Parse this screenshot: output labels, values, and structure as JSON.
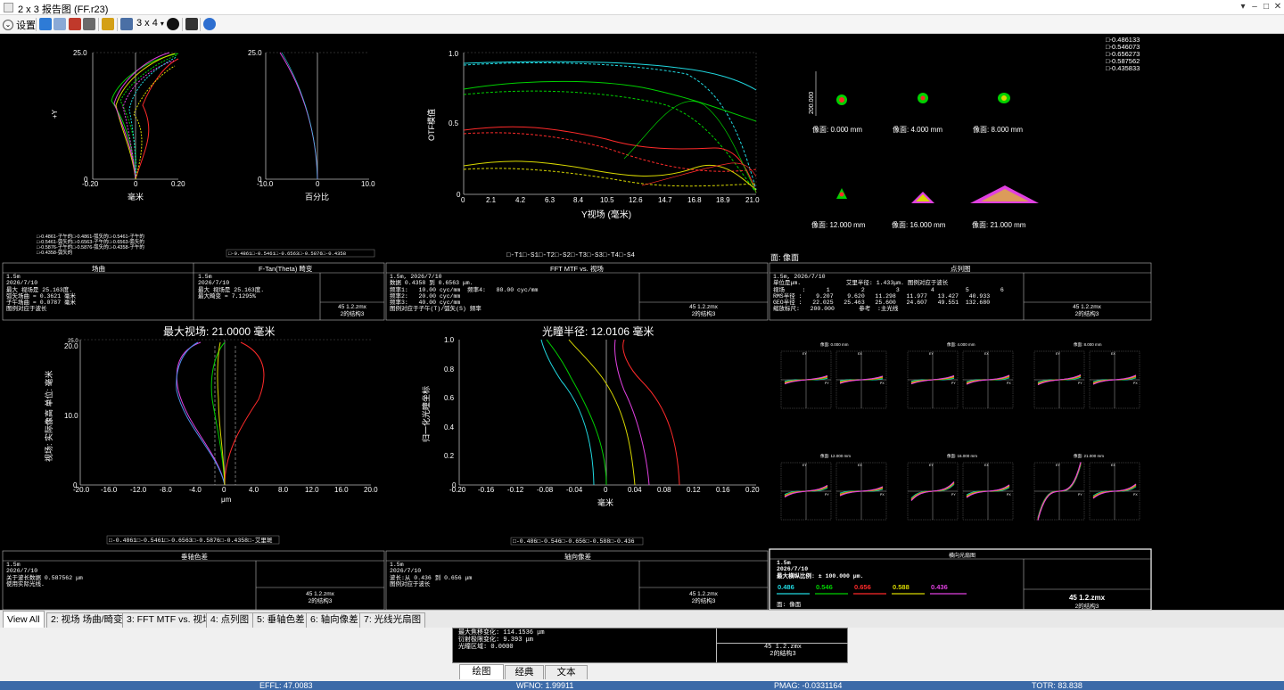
{
  "window": {
    "title": "2 x 3 报告图 (FF.r23)",
    "minimize": "▾",
    "restore": "–",
    "maximize": "□",
    "close": "✕"
  },
  "toolbar": {
    "settings_label": "设置",
    "layout_label": "3 x 4",
    "layout_arrow": "▾"
  },
  "field_curvature": {
    "y_top": "25.0",
    "y_bottom": "0",
    "y_label": "+Y",
    "x_ticks": [
      "-0.20",
      "0",
      "0.20"
    ],
    "x_unit": "毫米",
    "legend_lines": [
      "□-0.4861-子午的□-0.4861-弧矢的□-0.5461-子午的",
      "□-0.5461-弧矢的□-0.6563-子午的□-0.6563-弧矢的",
      "□-0.5876-子午的□-0.5876-弧矢的□-0.4358-子午的",
      "□-0.4358-弧矢的"
    ]
  },
  "distortion": {
    "y_top": "25.0",
    "y_bottom": "0",
    "x_ticks": [
      "-10.0",
      "0",
      "10.0"
    ],
    "x_unit": "百分比",
    "legend": "□-0.4861□-0.5461□-0.6563□-0.5876□-0.4358"
  },
  "mtf": {
    "y_ticks": [
      "1.0",
      "0.5",
      "0"
    ],
    "y_label": "OTF模值",
    "x_ticks": [
      "0",
      "2.1",
      "4.2",
      "6.3",
      "8.4",
      "10.5",
      "12.6",
      "14.7",
      "16.8",
      "18.9",
      "21.0"
    ],
    "x_label": "Y视场 (毫米)",
    "legend": "□-T1□-S1□-T2□-S2□-T3□-S3□-T4□-S4"
  },
  "spot": {
    "header": "面: 像面",
    "wavelengths": [
      "□-0.486133",
      "□-0.546073",
      "□-0.656273",
      "□-0.587562",
      "□-0.435833"
    ],
    "scale_label": "200.000",
    "fields": [
      "像面: 0.000 mm",
      "像面: 4.000 mm",
      "像面: 8.000 mm",
      "像面: 12.000 mm",
      "像面: 16.000 mm",
      "像面: 21.000 mm"
    ]
  },
  "info1": {
    "sec_a": "场曲",
    "sec_b": "F-Tan(Theta) 畸变",
    "sec_c": "FFT MTF vs. 视场",
    "sec_d": "点列图",
    "a_lines": "1.5m\n2026/7/10\n最大 视场是 25.163度.\n弧矢场曲 = 0.3621 毫米\n子午场曲 = 0.0787 毫米\n图例对应于波长",
    "b_lines": "1.5m\n2026/7/10\n最大 视场是 25.163度.\n最大畸变 = 7.1295%",
    "c_lines": "1.5m, 2026/7/10\n数据 0.4358 到 0.6563 μm.\n频率1:   10.00 cyc/mm  频率4:   80.00 cyc/mm\n频率2:   20.00 cyc/mm\n频率3:   40.00 cyc/mm\n图例对应于子午(T)/弧矢(S) 频率",
    "d_lines": "1.5m, 2026/7/10\n单位是μm.             艾里半径: 1.433μm. 图例对应于波长\n视场     :      1         2         3         4         5         6\nRMS半径 :    9.207    9.620   11.298   11.977   13.427   40.933\nGEO半径 :   22.025   25.463   25.600   24.607   49.551  132.680\n缩放标尺:   200.000       参考  :主光线",
    "file_name": "45 1.2.zmx",
    "config": "2的结构3"
  },
  "lateral_color": {
    "title": "最大视场: 21.0000 毫米",
    "y_label": "视场: 实际像高 单位: 毫米",
    "y_ticks": [
      "25.0",
      "20.0",
      "10.0",
      "0"
    ],
    "x_ticks": [
      "-20.0",
      "-16.0",
      "-12.0",
      "-8.0",
      "-4.0",
      "0",
      "4.0",
      "8.0",
      "12.0",
      "16.0",
      "20.0"
    ],
    "x_unit": "μm",
    "legend": "□-0.4861□-0.5461□-0.6563□-0.5876□-0.4358□-艾里斑"
  },
  "long_aberration": {
    "title": "光瞳半径: 12.0106 毫米",
    "y_label": "归一化光瞳坐标",
    "y_ticks": [
      "1.0",
      "0.8",
      "0.6",
      "0.4",
      "0.2",
      "0"
    ],
    "x_ticks": [
      "-0.20",
      "-0.16",
      "-0.12",
      "-0.08",
      "-0.04",
      "0",
      "0.04",
      "0.08",
      "0.12",
      "0.16",
      "0.20"
    ],
    "x_unit": "毫米",
    "legend": "□-0.486□-0.546□-0.656□-0.588□-0.436"
  },
  "ray_fan": {
    "fields": [
      "像面: 0.000 mm",
      "像面: 4.000 mm",
      "像面: 8.000 mm",
      "像面: 12.000 mm",
      "像面: 16.000 mm",
      "像面: 21.000 mm"
    ],
    "ey": "EY",
    "ex": "EX",
    "py": "PY",
    "px": "PX"
  },
  "info2": {
    "sec_a": "垂轴色差",
    "sec_b": "轴向像差",
    "sec_c": "横向光扇图",
    "a_lines": "1.5m\n2026/7/10\n关于波长数据 0.587562 μm\n使用实际光线.",
    "b_lines": "1.5m\n2026/7/10\n波长:从 0.436 到 0.656 μm\n图例对应于波长",
    "c_lines": "1.5m\n2026/7/10\n最大横纵比例: ± 100.000 μm.",
    "c_waves": [
      "0.486",
      "0.546",
      "0.656",
      "0.588",
      "0.436"
    ],
    "c_face": "面: 像面",
    "file_name": "45 1.2.zmx",
    "config": "2的结构3"
  },
  "tabs": [
    "View All",
    "2: 视场 场曲/畸变",
    "3: FFT MTF vs. 视场",
    "4: 点列图",
    "5: 垂轴色差",
    "6: 轴向像差",
    "7: 光线光扇图"
  ],
  "text_window": {
    "lines": "最大焦移变化: 114.1536 μm\n衍射极限变化: 9.393 μm\n光瞳区域: 0.0000",
    "file_name": "45 1.2.zmx",
    "config": "2的结构3"
  },
  "bottom_tabs": [
    "绘图",
    "经典",
    "文本"
  ],
  "status": {
    "effl": "EFFL: 47.0083",
    "wfno": "WFNO: 1.99911",
    "pmag": "PMAG: -0.0331164",
    "totr": "TOTR: 83.838"
  },
  "colors": {
    "blue": "#4a8fe8",
    "green": "#00d000",
    "red": "#ff2a2a",
    "yellow": "#d8d800",
    "magenta": "#e040e0",
    "cyan": "#20d8e0"
  }
}
